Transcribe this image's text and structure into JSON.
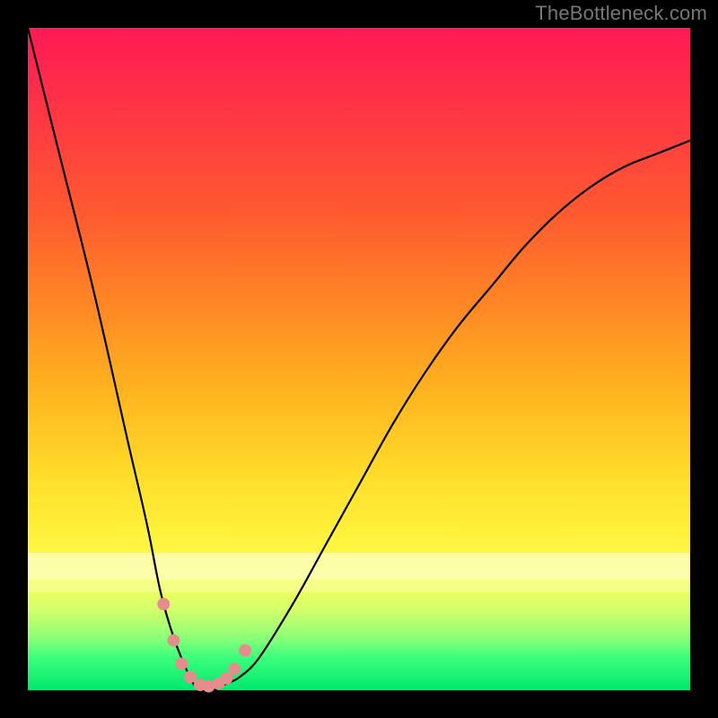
{
  "watermark": "TheBottleneck.com",
  "chart_data": {
    "type": "line",
    "title": "",
    "xlabel": "",
    "ylabel": "",
    "xlim": [
      0,
      100
    ],
    "ylim": [
      0,
      100
    ],
    "grid": false,
    "legend": false,
    "series": [
      {
        "name": "bottleneck-curve",
        "x": [
          0,
          5,
          10,
          15,
          18,
          20,
          22,
          24,
          25,
          26,
          28,
          30,
          32,
          35,
          40,
          45,
          50,
          55,
          60,
          65,
          70,
          75,
          80,
          85,
          90,
          95,
          100
        ],
        "values": [
          100,
          80,
          60,
          38,
          25,
          15,
          8,
          3,
          1,
          0,
          0,
          1,
          2,
          5,
          13,
          22,
          31,
          40,
          48,
          55,
          61,
          67,
          72,
          76,
          79,
          81,
          83
        ]
      }
    ],
    "markers": {
      "name": "highlight-dots",
      "x": [
        20.5,
        22.0,
        23.2,
        24.5,
        26.0,
        27.3,
        28.8,
        30.0,
        31.2,
        32.8
      ],
      "values": [
        13.0,
        7.5,
        4.0,
        2.0,
        0.8,
        0.6,
        1.0,
        1.8,
        3.2,
        6.0
      ]
    },
    "gradient_colors": {
      "top": "#ff1a55",
      "mid_upper": "#ff8825",
      "mid": "#ffde2a",
      "mid_lower": "#d0ff6a",
      "bottom": "#00e86e"
    }
  }
}
